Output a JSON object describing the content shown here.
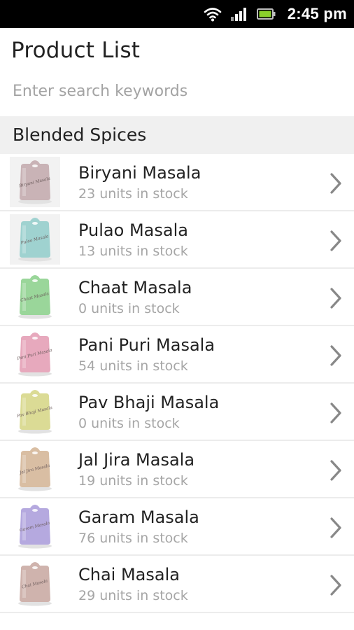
{
  "status_bar": {
    "time": "2:45 pm",
    "icons": [
      "wifi-icon",
      "signal-icon",
      "battery-icon"
    ]
  },
  "header": {
    "title": "Product List"
  },
  "search": {
    "placeholder": "Enter search keywords",
    "value": ""
  },
  "section": {
    "title": "Blended Spices"
  },
  "products": [
    {
      "name": "Biryani Masala",
      "stock": "23 units in stock",
      "bag_color": "#c9b3b6",
      "bag_label": "Biryani Masala"
    },
    {
      "name": "Pulao Masala",
      "stock": "13 units in stock",
      "bag_color": "#9fd2d0",
      "bag_label": "Pulao Masala"
    },
    {
      "name": "Chaat Masala",
      "stock": "0 units in stock",
      "bag_color": "#9ad69a",
      "bag_label": "Chaat Masala"
    },
    {
      "name": "Pani Puri Masala",
      "stock": "54 units in stock",
      "bag_color": "#e7a9bd",
      "bag_label": "Pani Puri Masala"
    },
    {
      "name": "Pav Bhaji Masala",
      "stock": "0 units in stock",
      "bag_color": "#dbdb95",
      "bag_label": "Pav Bhaji Masala"
    },
    {
      "name": "Jal Jira Masala",
      "stock": "19 units in stock",
      "bag_color": "#d9bea3",
      "bag_label": "Jal Jira Masala"
    },
    {
      "name": "Garam Masala",
      "stock": "76 units in stock",
      "bag_color": "#b5a9df",
      "bag_label": "Garam Masala"
    },
    {
      "name": "Chai Masala",
      "stock": "29 units in stock",
      "bag_color": "#cfb3ad",
      "bag_label": "Chai Masala"
    }
  ],
  "colors": {
    "status_bar_bg": "#000000",
    "section_bg": "#f0f0f0",
    "chevron": "#888888"
  }
}
